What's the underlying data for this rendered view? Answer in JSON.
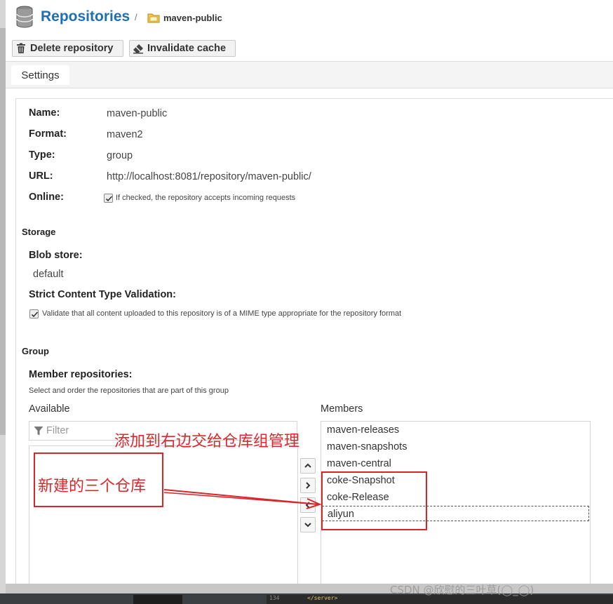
{
  "header": {
    "title": "Repositories",
    "separator": "/",
    "breadcrumb": "maven-public"
  },
  "toolbar": {
    "delete_label": "Delete repository",
    "invalidate_label": "Invalidate cache"
  },
  "tabs": [
    {
      "label": "Settings"
    }
  ],
  "settings": {
    "name_label": "Name:",
    "name_value": "maven-public",
    "format_label": "Format:",
    "format_value": "maven2",
    "type_label": "Type:",
    "type_value": "group",
    "url_label": "URL:",
    "url_value": "http://localhost:8081/repository/maven-public/",
    "online_label": "Online:",
    "online_checked": true,
    "online_help": "If checked, the repository accepts incoming requests"
  },
  "storage": {
    "section_title": "Storage",
    "blob_label": "Blob store:",
    "blob_value": "default",
    "strict_label": "Strict Content Type Validation:",
    "strict_checked": true,
    "strict_help": "Validate that all content uploaded to this repository is of a MIME type appropriate for the repository format"
  },
  "group": {
    "section_title": "Group",
    "member_label": "Member repositories:",
    "member_help": "Select and order the repositories that are part of this group",
    "available_label": "Available",
    "members_label": "Members",
    "filter_placeholder": "Filter",
    "members": [
      "maven-releases",
      "maven-snapshots",
      "maven-central",
      "coke-Snapshot",
      "coke-Release",
      "aliyun"
    ]
  },
  "annotations": {
    "add_note": "添加到右边交给仓库组管理",
    "new_note": "新建的三个仓库",
    "color": "#e0262b"
  },
  "footer": {
    "line_number": "134",
    "code_tag": "</server>",
    "watermark": "CSDN @欣慰的三叶草(◯_◯)"
  },
  "icons": [
    "database-icon",
    "folder-icon",
    "trash-icon",
    "eraser-icon",
    "filter-icon",
    "chevron-up-icon",
    "chevron-right-icon",
    "chevron-left-icon",
    "chevron-down-icon",
    "checkbox-icon"
  ]
}
